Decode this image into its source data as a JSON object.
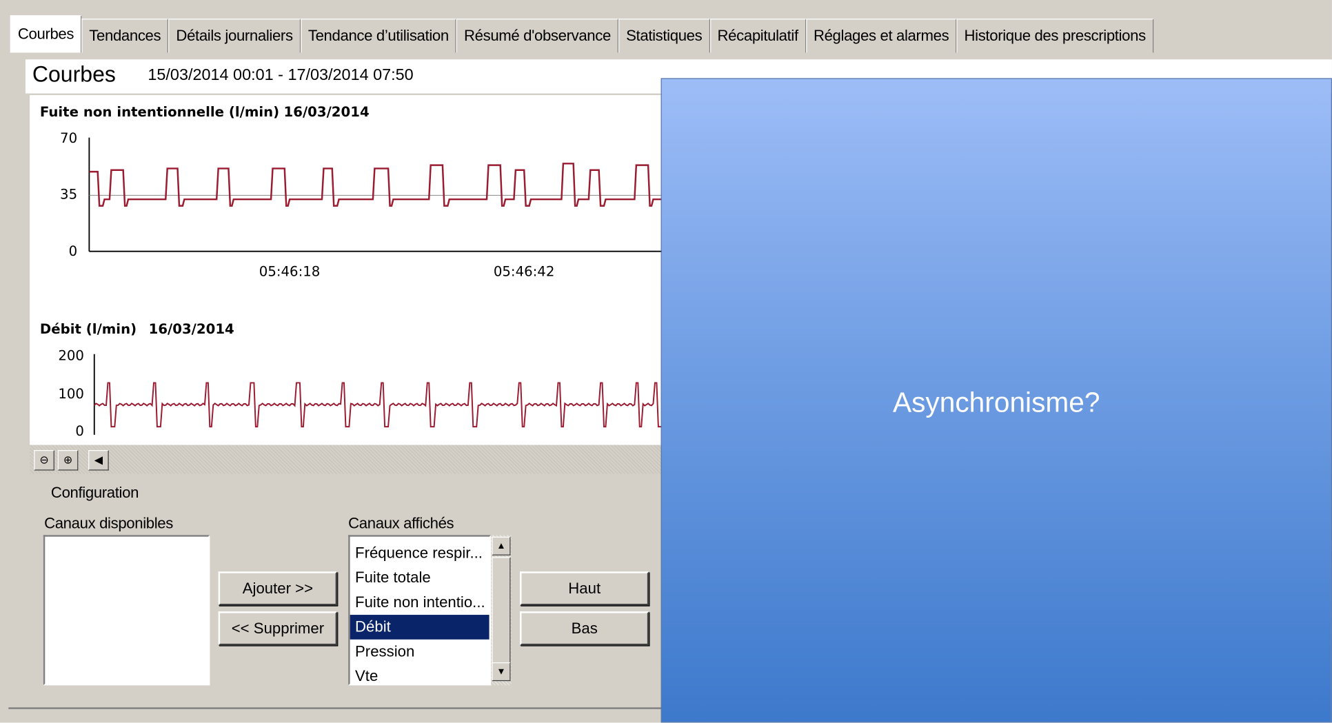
{
  "tabs": [
    {
      "label": "Courbes",
      "active": true
    },
    {
      "label": "Tendances"
    },
    {
      "label": "Détails journaliers"
    },
    {
      "label": "Tendance d’utilisation"
    },
    {
      "label": "Résumé d'observance"
    },
    {
      "label": "Statistiques"
    },
    {
      "label": "Récapitulatif"
    },
    {
      "label": "Réglages et alarmes"
    },
    {
      "label": "Historique des prescriptions"
    }
  ],
  "header": {
    "title": "Courbes",
    "date_range": "15/03/2014 00:01 - 17/03/2014 07:50"
  },
  "chart_data": [
    {
      "type": "line",
      "title": "Fuite non intentionnelle (l/min)",
      "date": "16/03/2014",
      "yticks": [
        "70",
        "35",
        "0"
      ],
      "ylim": [
        0,
        70
      ],
      "xticks": [
        "05:46:18",
        "05:46:42"
      ],
      "color": "#9b1b30",
      "baseline": 32,
      "bumps": [
        {
          "start": 0,
          "end": 0.03,
          "peak": 49
        },
        {
          "start": 0.065,
          "end": 0.105,
          "peak": 50
        },
        {
          "start": 0.235,
          "end": 0.275,
          "peak": 51
        },
        {
          "start": 0.395,
          "end": 0.43,
          "peak": 51
        },
        {
          "start": 0.56,
          "end": 0.6,
          "peak": 51
        },
        {
          "start": 0.715,
          "end": 0.75,
          "peak": 51
        },
        {
          "start": 0.875,
          "end": 0.92,
          "peak": 51
        },
        {
          "start": 1.045,
          "end": 1.09,
          "peak": 53
        },
        {
          "start": 1.225,
          "end": 1.265,
          "peak": 53
        },
        {
          "start": 1.305,
          "end": 1.34,
          "peak": 50
        },
        {
          "start": 1.455,
          "end": 1.49,
          "peak": 54
        },
        {
          "start": 1.535,
          "end": 1.57,
          "peak": 50
        },
        {
          "start": 1.68,
          "end": 1.72,
          "peak": 53
        }
      ]
    },
    {
      "type": "line",
      "title": "Débit (l/min)",
      "date": "16/03/2014",
      "yticks": [
        "200",
        "100",
        "0"
      ],
      "ylim": [
        0,
        200
      ],
      "xticks": [],
      "color": "#9b1b30",
      "baseline": 68,
      "spikes": [
        0.04,
        0.18,
        0.34,
        0.48,
        0.62,
        0.76,
        0.88,
        1.02,
        1.15,
        1.3,
        1.42,
        1.55,
        1.66,
        1.72,
        1.8
      ]
    }
  ],
  "config": {
    "title": "Configuration",
    "available_label": "Canaux disponibles",
    "displayed_label": "Canaux affichés",
    "displayed_items": [
      "Fréquence respir...",
      "Fuite totale",
      "Fuite non intentio...",
      "Débit",
      "Pression",
      "Vte"
    ],
    "selected": "Débit",
    "add_button": "Ajouter >>",
    "remove_button": "<< Supprimer",
    "up_button": "Haut",
    "down_button": "Bas"
  },
  "overlay": {
    "text": "Asynchronisme?"
  }
}
